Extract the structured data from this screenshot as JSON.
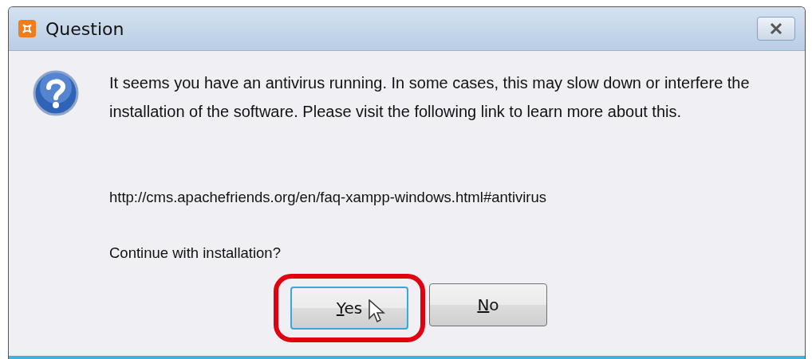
{
  "window": {
    "title": "Question"
  },
  "message": "It seems you have an antivirus running. In some cases, this may slow down or interfere the installation of the software. Please visit the following link to learn more about this.",
  "link": "http://cms.apachefriends.org/en/faq-xampp-windows.html#antivirus",
  "question": "Continue with installation?",
  "buttons": [
    {
      "label": "Yes",
      "underline_first": true,
      "focused": true,
      "highlighted": true,
      "hovered": true
    },
    {
      "label": "No",
      "underline_first": true,
      "focused": false,
      "highlighted": false,
      "hovered": false
    }
  ]
}
